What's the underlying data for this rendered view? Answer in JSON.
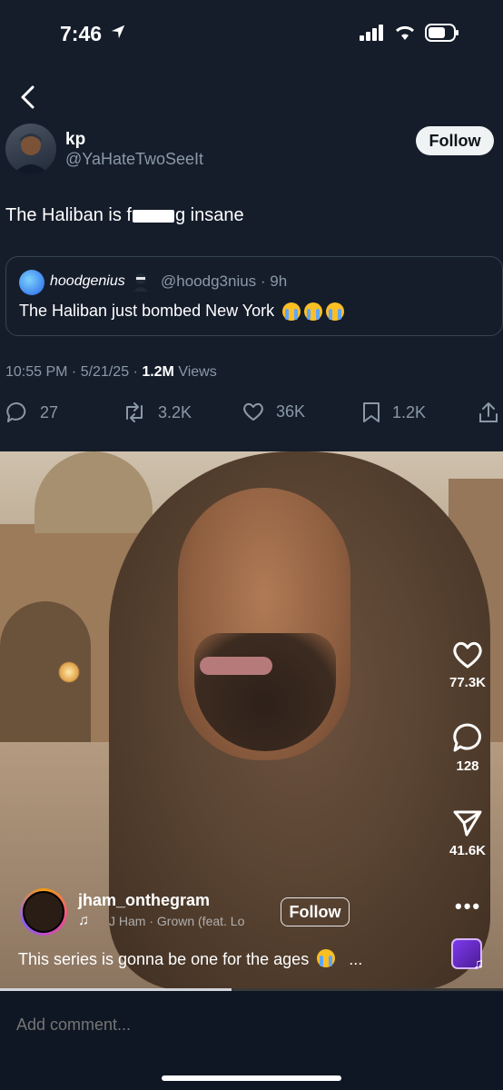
{
  "status_bar": {
    "time": "7:46"
  },
  "tweet": {
    "author_name": "kp",
    "author_handle": "@YaHateTwoSeeIt",
    "follow_label": "Follow",
    "text_before": "The Haliban is f",
    "text_after": "g insane",
    "quote": {
      "name": "hoodgenius",
      "handle_time": "@hoodg3nius · 9h",
      "text": "The Haliban just bombed New York"
    },
    "meta_time": "10:55 PM · 5/21/25 · ",
    "meta_views_count": "1.2M",
    "meta_views_label": " Views",
    "actions": {
      "replies": "27",
      "reposts": "3.2K",
      "likes": "36K",
      "bookmarks": "1.2K"
    }
  },
  "video": {
    "likes": "77.3K",
    "comments": "128",
    "shares": "41.6K",
    "creator": "jham_onthegram",
    "music": "J Ham · Grown (feat. Lo",
    "follow_label": "Follow",
    "caption": "This series is gonna be one for the ages",
    "caption_more": "...",
    "progress": 0.46
  },
  "comment": {
    "placeholder": "Add comment..."
  },
  "icons": {
    "back": "chevron-left-icon",
    "reply": "speech-bubble-icon",
    "repost": "repost-icon",
    "like": "heart-icon",
    "bookmark": "bookmark-icon",
    "share": "share-icon",
    "send": "paper-plane-icon",
    "music": "music-note-icon"
  }
}
